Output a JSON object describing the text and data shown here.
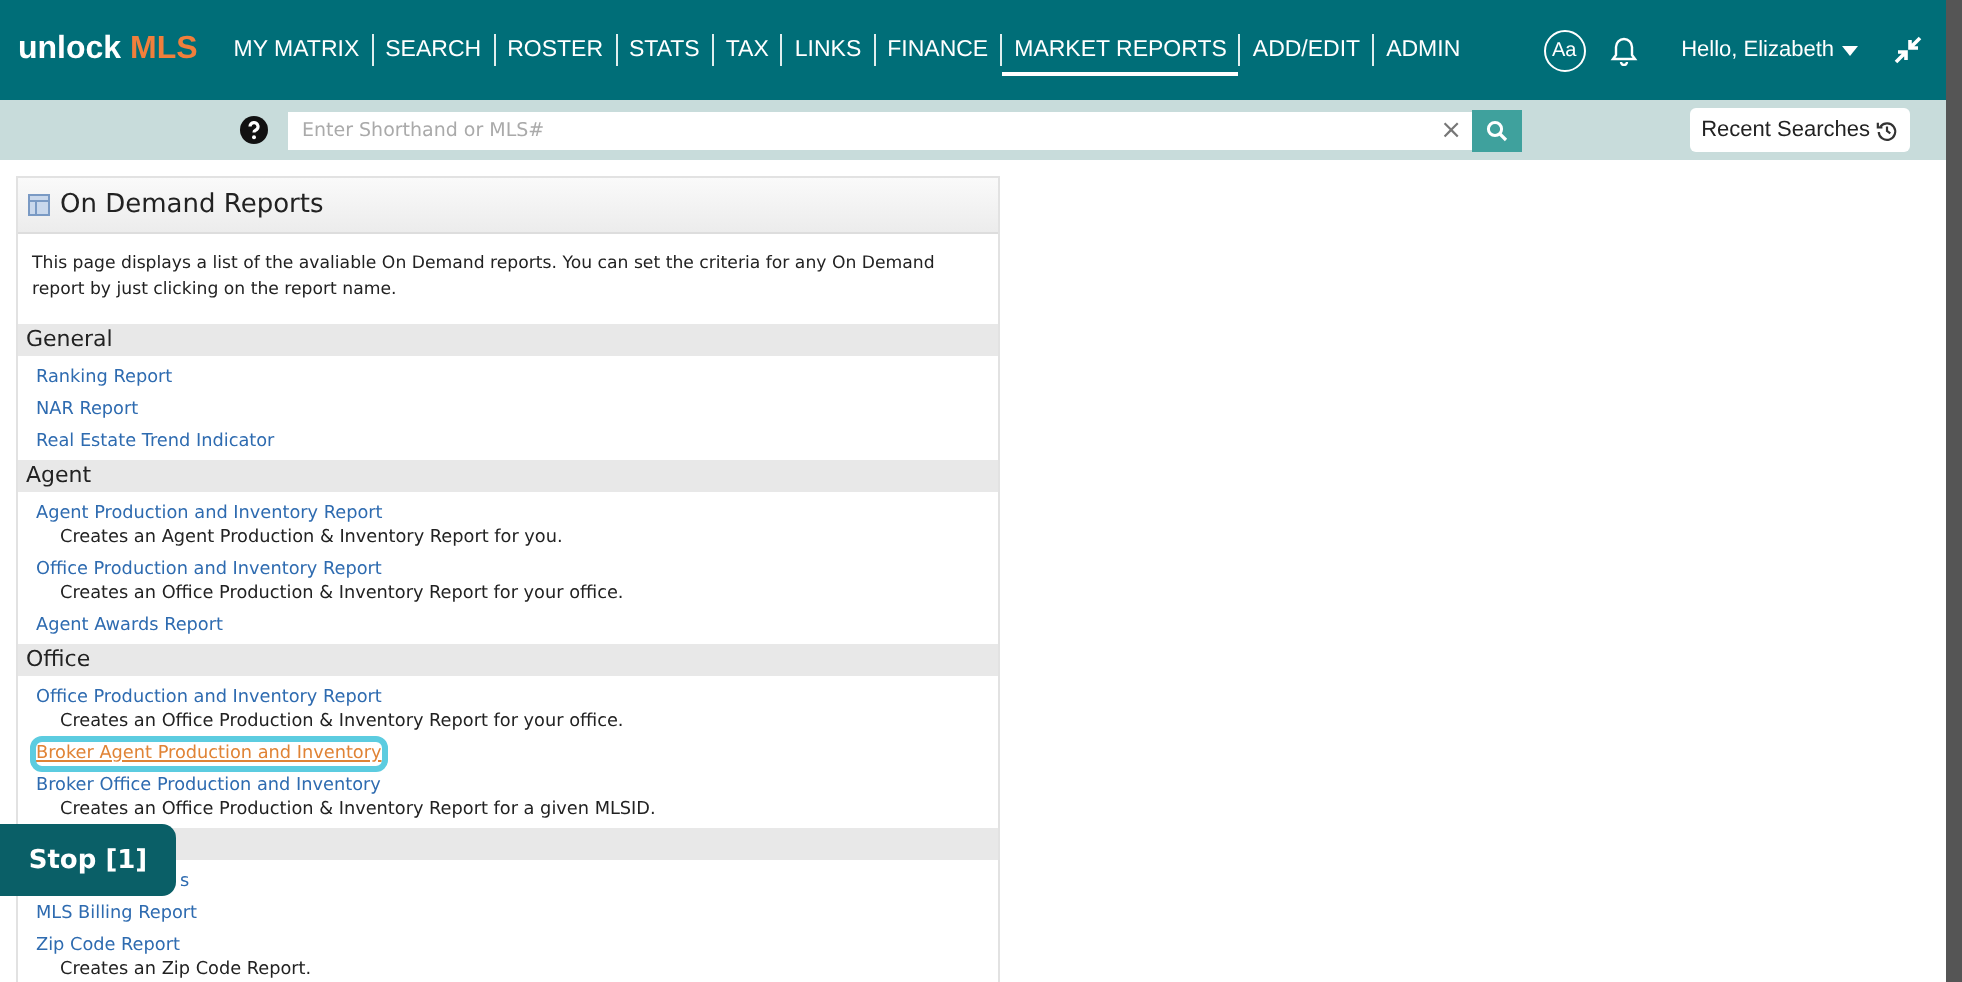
{
  "header": {
    "logo": {
      "part1": "unlock",
      "part2": "MLS"
    },
    "nav": [
      {
        "label": "MY MATRIX",
        "selected": false
      },
      {
        "label": "SEARCH",
        "selected": false
      },
      {
        "label": "ROSTER",
        "selected": false
      },
      {
        "label": "STATS",
        "selected": false
      },
      {
        "label": "TAX",
        "selected": false
      },
      {
        "label": "LINKS",
        "selected": false
      },
      {
        "label": "FINANCE",
        "selected": false
      },
      {
        "label": "MARKET REPORTS",
        "selected": true
      },
      {
        "label": "ADD/EDIT",
        "selected": false
      },
      {
        "label": "ADMIN",
        "selected": false
      }
    ],
    "font_button": "Aa",
    "user_menu": "Hello, Elizabeth"
  },
  "search": {
    "placeholder": "Enter Shorthand or MLS#",
    "clear": "×",
    "recent": "Recent Searches"
  },
  "panel": {
    "title": "On Demand Reports",
    "intro": "This page displays a list of the avaliable On Demand reports. You can set the criteria for any On Demand report by just clicking on the report name.",
    "sections": [
      {
        "title": "General",
        "items": [
          {
            "label": "Ranking Report",
            "focused": false
          },
          {
            "label": "NAR Report",
            "focused": false
          },
          {
            "label": "Real Estate Trend Indicator",
            "focused": false
          }
        ]
      },
      {
        "title": "Agent",
        "items": [
          {
            "label": "Agent Production and Inventory Report",
            "description": "Creates an Agent Production & Inventory Report for you.",
            "focused": false
          },
          {
            "label": "Office Production and Inventory Report",
            "description": "Creates an Office Production & Inventory Report for your office.",
            "focused": false
          },
          {
            "label": "Agent Awards Report",
            "focused": false
          }
        ]
      },
      {
        "title": "Office",
        "items": [
          {
            "label": "Office Production and Inventory Report",
            "description": "Creates an Office Production & Inventory Report for your office.",
            "focused": false
          },
          {
            "label": "Broker Agent Production and Inventory",
            "focused": true
          },
          {
            "label": "Broker Office Production and Inventory",
            "description": "Creates an Office Production & Inventory Report for a given MLSID.",
            "focused": false
          }
        ]
      },
      {
        "items": [
          {
            "label": "s",
            "focused": false,
            "obscured": true
          },
          {
            "label": "MLS Billing Report",
            "focused": false
          },
          {
            "label": "Zip Code Report",
            "description": "Creates an Zip Code Report.",
            "focused": false
          }
        ]
      }
    ]
  },
  "overlay": {
    "label": "Stop [1]"
  }
}
